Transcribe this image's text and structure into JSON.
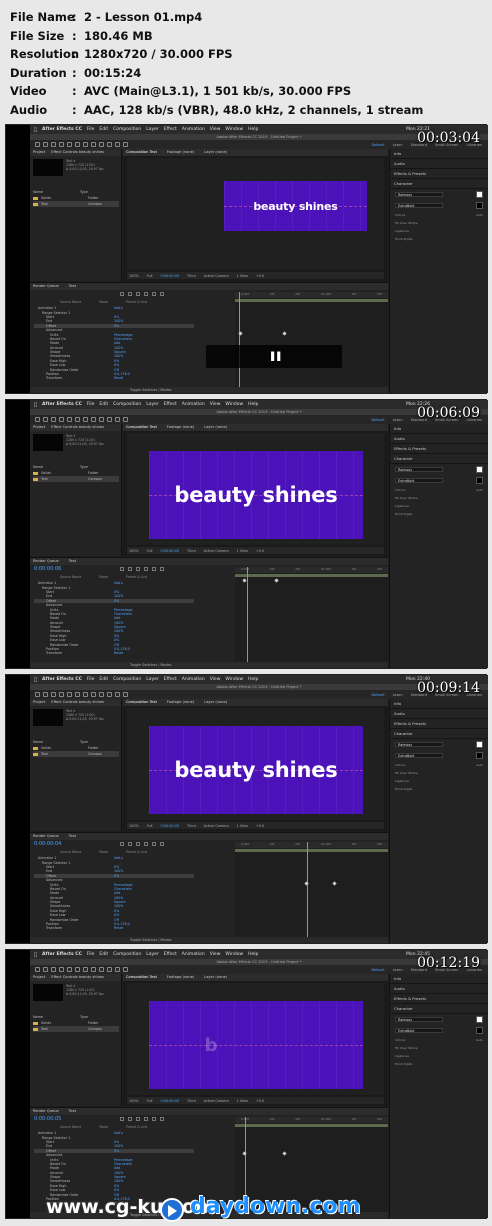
{
  "info": [
    {
      "key": "File Name",
      "value": "2 - Lesson 01.mp4"
    },
    {
      "key": "File Size",
      "value": "180.46 MB"
    },
    {
      "key": "Resolution",
      "value": "1280x720 / 30.000 FPS"
    },
    {
      "key": "Duration",
      "value": "00:15:24"
    },
    {
      "key": "Video",
      "value": "AVC (Main@L3.1), 1 501 kb/s, 30.000 FPS"
    },
    {
      "key": "Audio",
      "value": "AAC, 128 kb/s (VBR), 48.0 kHz, 2 channels, 1 stream"
    }
  ],
  "info_separator": ":",
  "thumbnails": [
    {
      "timestamp": "00:03:04",
      "canvas_text": "beauty shines",
      "clock": "Mon 22:21",
      "timeline_time": "",
      "has_playbar": true
    },
    {
      "timestamp": "00:06:09",
      "canvas_text": "beauty shines",
      "clock": "Mon 22:26",
      "timeline_time": "0:00:00:06",
      "has_playbar": false
    },
    {
      "timestamp": "00:09:14",
      "canvas_text": "beauty shines",
      "clock": "Mon 22:40",
      "timeline_time": "0:00:00:04",
      "has_playbar": false
    },
    {
      "timestamp": "00:12:19",
      "canvas_text": "b",
      "clock": "Mon 22:45",
      "timeline_time": "0:00:00:05",
      "has_playbar": false
    }
  ],
  "ae": {
    "menu": [
      "After Effects CC",
      "File",
      "Edit",
      "Composition",
      "Layer",
      "Effect",
      "Animation",
      "View",
      "Window",
      "Help"
    ],
    "window_title": "Adobe After Effects CC 2019 - Untitled Project *",
    "workspaces": [
      "Default",
      "Learn",
      "Standard",
      "Small Screen",
      "Libraries"
    ],
    "project_tabs": [
      "Project",
      "Effect Controls beauty shines"
    ],
    "project_meta": [
      "Text ▾",
      "1280 x 720 (1.00)",
      "Δ 0;00;11;00, 29.97 fps"
    ],
    "project_items": [
      {
        "name": "Name",
        "type": "Type"
      },
      {
        "name": "Solids",
        "type": "Folder"
      },
      {
        "name": "Text",
        "type": "Compos"
      }
    ],
    "comp_tabs": [
      "Composition Text",
      "Footage (none)",
      "Layer (none)"
    ],
    "comp_subtab": "Text",
    "viewer_bar": [
      "100%",
      "Full",
      "0:00:00:00",
      "Third",
      "Active Camera",
      "1 View",
      "+0.0"
    ],
    "right_sections": [
      "Info",
      "Audio",
      "Effects & Presets",
      "Character"
    ],
    "font_name": "Raleway",
    "font_style": "ExtraBold",
    "font_size": "120 px",
    "tracking": "Auto",
    "stroke": "Fill Over Stroke",
    "right_labels": [
      "Ligatures",
      "Hindi Digits"
    ],
    "timeline_tabs": [
      "Render Queue",
      "Text"
    ],
    "timeline_cols": [
      "Source Name",
      "Mode",
      "Parent & Link"
    ],
    "props": [
      {
        "name": "Animator 1",
        "value": "Add ▸"
      },
      {
        "name": "Range Selector 1",
        "value": ""
      },
      {
        "name": "Start",
        "value": "0%"
      },
      {
        "name": "End",
        "value": "100%"
      },
      {
        "name": "Offset",
        "value": "0%"
      },
      {
        "name": "Advanced",
        "value": ""
      },
      {
        "name": "Units",
        "value": "Percentage"
      },
      {
        "name": "Based On",
        "value": "Characters"
      },
      {
        "name": "Mode",
        "value": "Add"
      },
      {
        "name": "Amount",
        "value": "100%"
      },
      {
        "name": "Shape",
        "value": "Square"
      },
      {
        "name": "Smoothness",
        "value": "100%"
      },
      {
        "name": "Ease High",
        "value": "0%"
      },
      {
        "name": "Ease Low",
        "value": "0%"
      },
      {
        "name": "Randomize Order",
        "value": "Off"
      },
      {
        "name": "Position",
        "value": "0.0,176.0"
      },
      {
        "name": "Transform",
        "value": "Reset"
      }
    ],
    "ruler": [
      "0:00f",
      "10f",
      "20f",
      "01:00f",
      "10f",
      "20f"
    ],
    "footer": "Toggle Switches / Modes"
  },
  "watermark": {
    "left": "www.cg-ku.com",
    "right": "daydown.com"
  },
  "colors": {
    "canvas": "#4a12b8",
    "accent_blue": "#4da3ff",
    "background": "#e8e8e8"
  }
}
